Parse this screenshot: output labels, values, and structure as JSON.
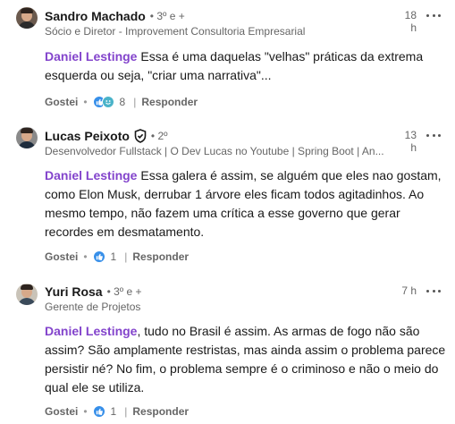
{
  "comments": [
    {
      "name": "Sandro Machado",
      "degree": "• 3º e +",
      "subtitle": "Sócio e Diretor - Improvement Consultoria Empresarial",
      "time": "18 h",
      "mention": "Daniel Lestinge",
      "text": " Essa é uma daquelas \"velhas\" práticas da extrema esquerda ou seja, \"criar uma narrativa\"...",
      "like_label": "Gostei",
      "reactions": [
        "like-icon",
        "smile-icon"
      ],
      "reaction_count": "8",
      "reply_label": "Responder"
    },
    {
      "name": "Lucas Peixoto",
      "degree": "• 2º",
      "subtitle": "Desenvolvedor Fullstack | O Dev Lucas no Youtube | Spring Boot | An...",
      "time": "13 h",
      "mention": "Daniel Lestinge",
      "text": " Essa galera é assim, se alguém que eles nao gostam, como Elon Musk, derrubar 1 árvore eles ficam todos agitadinhos. Ao mesmo tempo, não fazem uma crítica a esse governo que gerar recordes em desmatamento.",
      "like_label": "Gostei",
      "reactions": [
        "like-icon"
      ],
      "reaction_count": "1",
      "reply_label": "Responder"
    },
    {
      "name": "Yuri Rosa",
      "degree": "• 3º e +",
      "subtitle": "Gerente de Projetos",
      "time": "7 h",
      "mention": "Daniel Lestinge",
      "text": ", tudo no Brasil é assim. As armas de fogo não são assim? São amplamente restristas, mas ainda assim o problema parece persistir né? No fim, o problema sempre é o criminoso e não o meio do qual ele se utiliza.",
      "like_label": "Gostei",
      "reactions": [
        "like-icon"
      ],
      "reaction_count": "1",
      "reply_label": "Responder"
    }
  ],
  "colors": {
    "mention": "#8344cc",
    "like": "#378fe9",
    "muted": "#666666"
  }
}
